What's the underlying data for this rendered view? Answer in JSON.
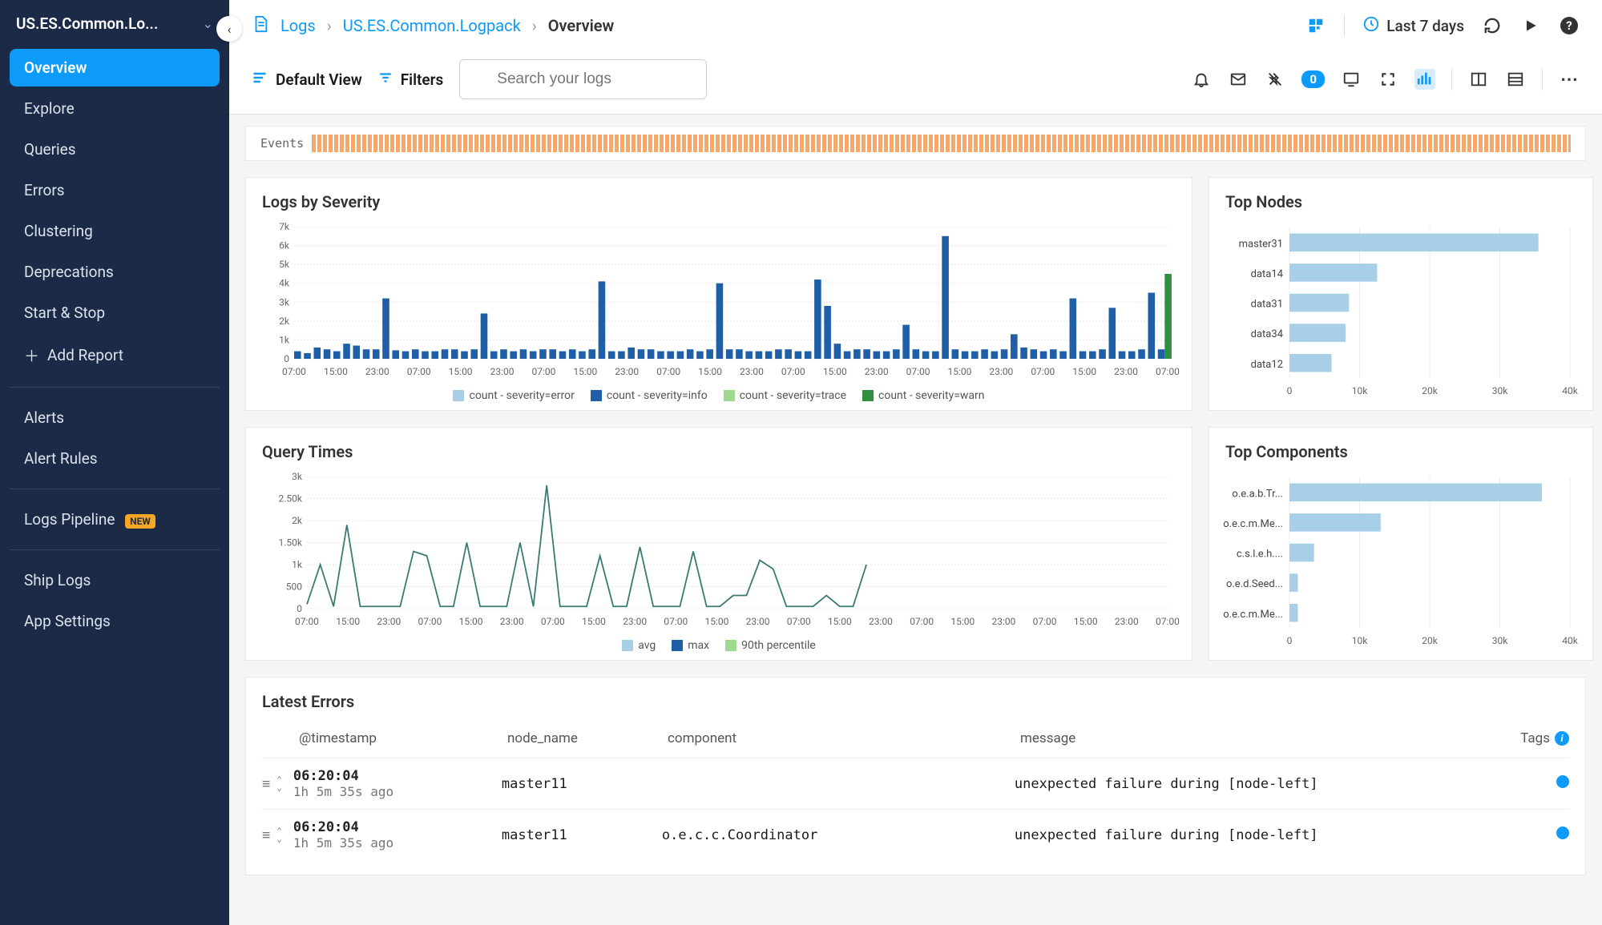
{
  "sidebar": {
    "app_name": "US.ES.Common.Lo...",
    "items": [
      {
        "label": "Overview",
        "active": true
      },
      {
        "label": "Explore"
      },
      {
        "label": "Queries"
      },
      {
        "label": "Errors"
      },
      {
        "label": "Clustering"
      },
      {
        "label": "Deprecations"
      },
      {
        "label": "Start & Stop"
      }
    ],
    "add_report": "Add Report",
    "alerts": "Alerts",
    "alert_rules": "Alert Rules",
    "logs_pipeline": "Logs Pipeline",
    "logs_pipeline_badge": "NEW",
    "ship_logs": "Ship Logs",
    "app_settings": "App Settings"
  },
  "breadcrumb": {
    "logs": "Logs",
    "pack": "US.ES.Common.Logpack",
    "current": "Overview"
  },
  "header": {
    "time_range": "Last 7 days"
  },
  "toolbar": {
    "default_view": "Default View",
    "filters": "Filters",
    "search_placeholder": "Search your logs",
    "badge_count": "0"
  },
  "events_label": "Events",
  "panels": {
    "logs_by_severity_title": "Logs by Severity",
    "query_times_title": "Query Times",
    "top_nodes_title": "Top Nodes",
    "top_components_title": "Top Components",
    "latest_errors_title": "Latest Errors"
  },
  "latest_errors": {
    "headers": {
      "timestamp": "@timestamp",
      "node_name": "node_name",
      "component": "component",
      "message": "message",
      "tags": "Tags"
    },
    "rows": [
      {
        "ts": "06:20:04",
        "ago": "1h 5m 35s ago",
        "node": "master11",
        "component": "",
        "message": "unexpected failure during [node-left]"
      },
      {
        "ts": "06:20:04",
        "ago": "1h 5m 35s ago",
        "node": "master11",
        "component": "o.e.c.c.Coordinator",
        "message": "unexpected failure during [node-left]"
      }
    ]
  },
  "chart_data": [
    {
      "id": "logs_by_severity",
      "type": "bar",
      "title": "Logs by Severity",
      "ylabel": "",
      "ylim": [
        0,
        7000
      ],
      "yticks": [
        0,
        1000,
        2000,
        3000,
        4000,
        5000,
        6000,
        7000
      ],
      "ytick_labels": [
        "0",
        "1k",
        "2k",
        "3k",
        "4k",
        "5k",
        "6k",
        "7k"
      ],
      "x_labels": [
        "07:00",
        "15:00",
        "23:00",
        "07:00",
        "15:00",
        "23:00",
        "07:00",
        "15:00",
        "23:00",
        "07:00",
        "15:00",
        "23:00",
        "07:00",
        "15:00",
        "23:00",
        "07:00",
        "15:00",
        "23:00",
        "07:00",
        "15:00",
        "23:00",
        "07:00"
      ],
      "legend": [
        {
          "name": "count - severity=error",
          "color": "#a7cfe8"
        },
        {
          "name": "count - severity=info",
          "color": "#1f5fa8"
        },
        {
          "name": "count - severity=trace",
          "color": "#9fd98f"
        },
        {
          "name": "count - severity=warn",
          "color": "#2f8f3f"
        }
      ],
      "data": [
        400,
        300,
        600,
        500,
        400,
        800,
        700,
        500,
        500,
        3200,
        450,
        400,
        500,
        400,
        400,
        500,
        500,
        400,
        500,
        2400,
        400,
        500,
        400,
        500,
        400,
        500,
        500,
        400,
        500,
        400,
        500,
        4100,
        400,
        400,
        600,
        500,
        500,
        400,
        400,
        400,
        500,
        400,
        500,
        4000,
        500,
        500,
        400,
        400,
        400,
        500,
        500,
        400,
        400,
        4200,
        2800,
        800,
        400,
        500,
        500,
        400,
        400,
        500,
        1800,
        500,
        400,
        400,
        6500,
        500,
        400,
        400,
        500,
        400,
        500,
        1300,
        600,
        500,
        400,
        500,
        400,
        3200,
        400,
        400,
        500,
        2700,
        400,
        400,
        500,
        3500,
        500
      ],
      "warn_last": 4500
    },
    {
      "id": "query_times",
      "type": "line",
      "title": "Query Times",
      "ylim": [
        0,
        3000
      ],
      "yticks": [
        0,
        500,
        1000,
        1500,
        2000,
        2500,
        3000
      ],
      "ytick_labels": [
        "0",
        "500",
        "1k",
        "1.50k",
        "2k",
        "2.50k",
        "3k"
      ],
      "x_labels": [
        "07:00",
        "15:00",
        "23:00",
        "07:00",
        "15:00",
        "23:00",
        "07:00",
        "15:00",
        "23:00",
        "07:00",
        "15:00",
        "23:00",
        "07:00",
        "15:00",
        "23:00",
        "07:00",
        "15:00",
        "23:00",
        "07:00",
        "15:00",
        "23:00",
        "07:00"
      ],
      "legend": [
        {
          "name": "avg",
          "color": "#a7cfe8"
        },
        {
          "name": "max",
          "color": "#1f5fa8"
        },
        {
          "name": "90th percentile",
          "color": "#9fd98f"
        }
      ],
      "data": [
        100,
        1000,
        50,
        1900,
        50,
        50,
        50,
        50,
        1300,
        1200,
        50,
        50,
        1500,
        50,
        50,
        50,
        1500,
        50,
        2800,
        50,
        50,
        50,
        1200,
        50,
        50,
        1400,
        50,
        50,
        50,
        1300,
        50,
        50,
        300,
        300,
        1100,
        900,
        50,
        50,
        50,
        300,
        50,
        50,
        1000
      ]
    },
    {
      "id": "top_nodes",
      "type": "bar",
      "orientation": "horizontal",
      "title": "Top Nodes",
      "xlim": [
        0,
        40000
      ],
      "xticks": [
        0,
        10000,
        20000,
        30000,
        40000
      ],
      "xtick_labels": [
        "0",
        "10k",
        "20k",
        "30k",
        "40k"
      ],
      "categories": [
        "master31",
        "data14",
        "data31",
        "data34",
        "data12"
      ],
      "values": [
        35500,
        12500,
        8500,
        8000,
        6000
      ]
    },
    {
      "id": "top_components",
      "type": "bar",
      "orientation": "horizontal",
      "title": "Top Components",
      "xlim": [
        0,
        40000
      ],
      "xticks": [
        0,
        10000,
        20000,
        30000,
        40000
      ],
      "xtick_labels": [
        "0",
        "10k",
        "20k",
        "30k",
        "40k"
      ],
      "categories": [
        "o.e.a.b.Tr...",
        "o.e.c.m.Me...",
        "c.s.l.e.h....",
        "o.e.d.Seed...",
        "o.e.c.m.Me..."
      ],
      "values": [
        36000,
        13000,
        3500,
        1200,
        1200
      ]
    }
  ]
}
